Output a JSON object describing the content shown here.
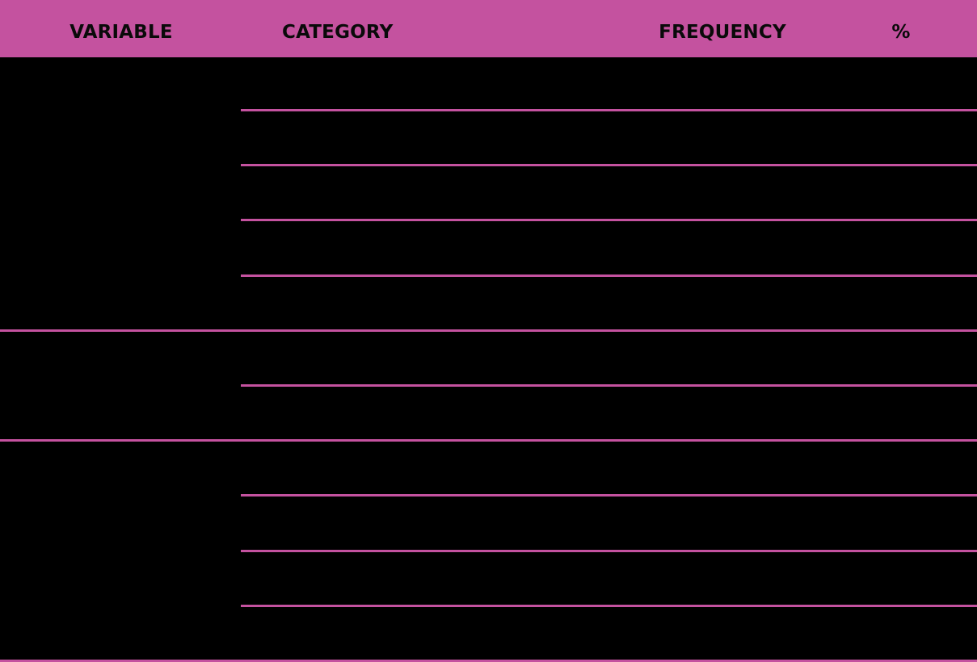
{
  "table": {
    "columns": {
      "variable": "VARIABLE",
      "category": "CATEGORY",
      "frequency": "FREQUENCY",
      "percent": "%"
    }
  },
  "colors": {
    "accent": "#c4529f",
    "background": "#000000",
    "header_text": "#0a0a0a"
  }
}
